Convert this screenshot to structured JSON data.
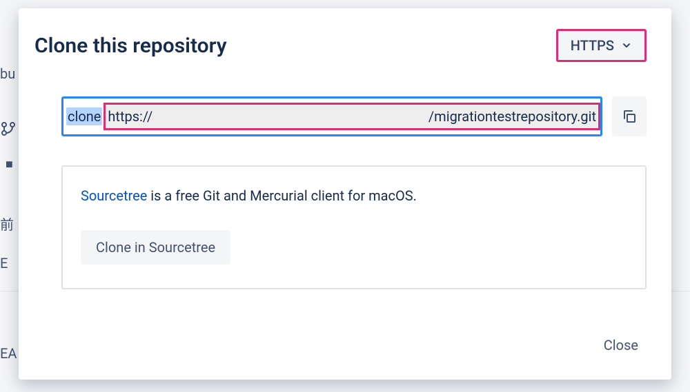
{
  "backdrop": {
    "bu": "bu",
    "char1": "前",
    "char2": "E",
    "ea": "EA"
  },
  "modal": {
    "title": "Clone this repository",
    "protocol": "HTTPS",
    "clone_prefix": "clone",
    "url_left": "https://",
    "url_right": "/migrationtestrepository.git",
    "sourcetree_link": "Sourcetree",
    "sourcetree_rest": " is a free Git and Mercurial client for macOS.",
    "sourcetree_button": "Clone in Sourcetree",
    "close": "Close"
  }
}
